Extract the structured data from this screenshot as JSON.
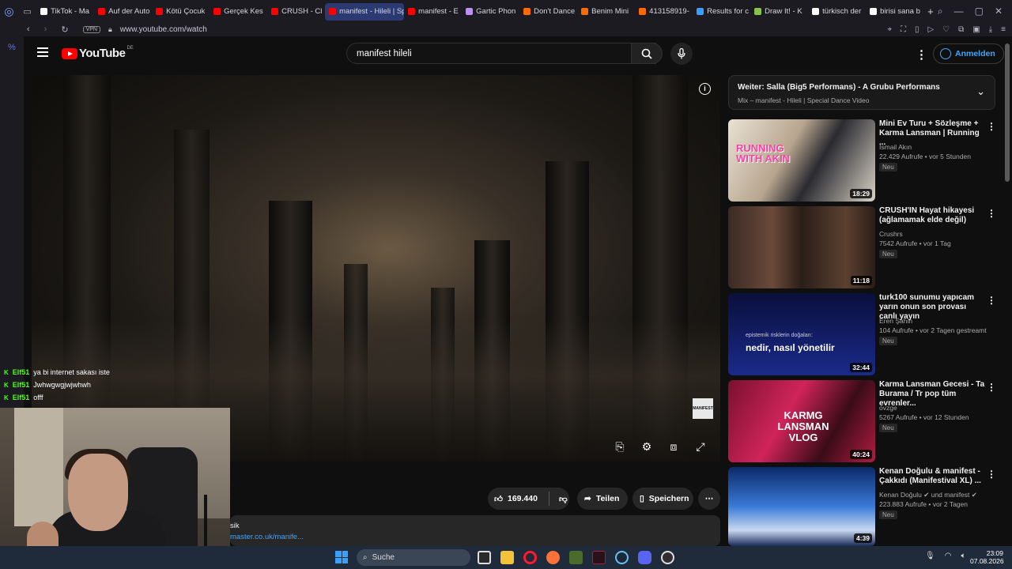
{
  "browser": {
    "tabs": [
      {
        "label": "TikTok - Ma",
        "color": "#ffffff"
      },
      {
        "label": "Auf der Auto",
        "color": "#ff0000"
      },
      {
        "label": "Kötü Çocuk",
        "color": "#ff0000"
      },
      {
        "label": "Gerçek Kes",
        "color": "#ff0000"
      },
      {
        "label": "CRUSH - Cl",
        "color": "#ff0000"
      },
      {
        "label": "manifest - Hileli | Spe",
        "color": "#ff0000",
        "active": true
      },
      {
        "label": "manifest - E",
        "color": "#ff0000"
      },
      {
        "label": "Gartic Phon",
        "color": "#c08bff"
      },
      {
        "label": "Don't Dance",
        "color": "#ff6a00"
      },
      {
        "label": "Benim Mini",
        "color": "#ff6a00"
      },
      {
        "label": "413158919-",
        "color": "#ff6a00"
      },
      {
        "label": "Results for c",
        "color": "#3aa0ff"
      },
      {
        "label": "Draw It! - K",
        "color": "#8bc34a"
      },
      {
        "label": "türkisch der",
        "color": "#ffffff"
      },
      {
        "label": "birisi sana b",
        "color": "#ffffff"
      }
    ],
    "new_tab": "+",
    "vpn_label": "VPN",
    "url": "www.youtube.com/watch"
  },
  "youtube": {
    "logo_text": "YouTube",
    "logo_region": "DE",
    "search_value": "manifest hileli",
    "signin_label": "Anmelden"
  },
  "chat": [
    {
      "user": "Elf51",
      "message": "ya bi internet sakası iste"
    },
    {
      "user": "Elf51",
      "message": "Jwhwgwgjwjwhwh"
    },
    {
      "user": "Elf51",
      "message": "offf"
    }
  ],
  "player": {
    "watermark": "MANIFEST"
  },
  "actions": {
    "likes": "169.440",
    "share": "Teilen",
    "save": "Speichern"
  },
  "description": {
    "line1": "sik",
    "line2": "master.co.uk/manife..."
  },
  "upnext": {
    "title": "Weiter: Salla (Big5 Performans) - A Grubu Performans",
    "subtitle": "Mix – manifest - Hileli | Special Dance Video"
  },
  "recommended": [
    {
      "title": "Mini Ev Turu + Sözleşme + Karma Lansman | Running ...",
      "channel": "İsmail Akın",
      "meta": "22.429 Aufrufe • vor 5 Stunden",
      "badge": "Neu",
      "duration": "18:29"
    },
    {
      "title": "CRUSH'IN Hayat hikayesi (ağlamamak elde değil)",
      "channel": "Crushrs",
      "meta": "7542 Aufrufe • vor 1 Tag",
      "badge": "Neu",
      "duration": "11:18"
    },
    {
      "title": "turk100 sunumu yapıcam yarın onun son provası canlı yayın",
      "channel": "Eren Şahin",
      "meta": "104 Aufrufe • vor 2 Tagen gestreamt",
      "badge": "Neu",
      "duration": "32:44"
    },
    {
      "title": "Karma Lansman Gecesi - Ta Burama / Tr pop tüm evrenler...",
      "channel": "ovzge",
      "meta": "5267 Aufrufe • vor 12 Stunden",
      "badge": "Neu",
      "duration": "40:24"
    },
    {
      "title": "Kenan Doğulu & manifest - Çakkıdı (Manifestival XL) ...",
      "channel": "Kenan Doğulu ✔ und manifest ✔",
      "meta": "223.883 Aufrufe • vor 2 Tagen",
      "badge": "Neu",
      "duration": "4:39"
    }
  ],
  "thumb_texts": {
    "t1": "RUNNING WITH AKIN",
    "t3_small": "epistemik risklerin doğaları:",
    "t3_big": "nedir, nasıl yönetilir",
    "t4": "KARMG LANSMAN VLOG"
  },
  "taskbar": {
    "search_label": "Suche",
    "time": "23:09",
    "date": "07.08.2026"
  }
}
